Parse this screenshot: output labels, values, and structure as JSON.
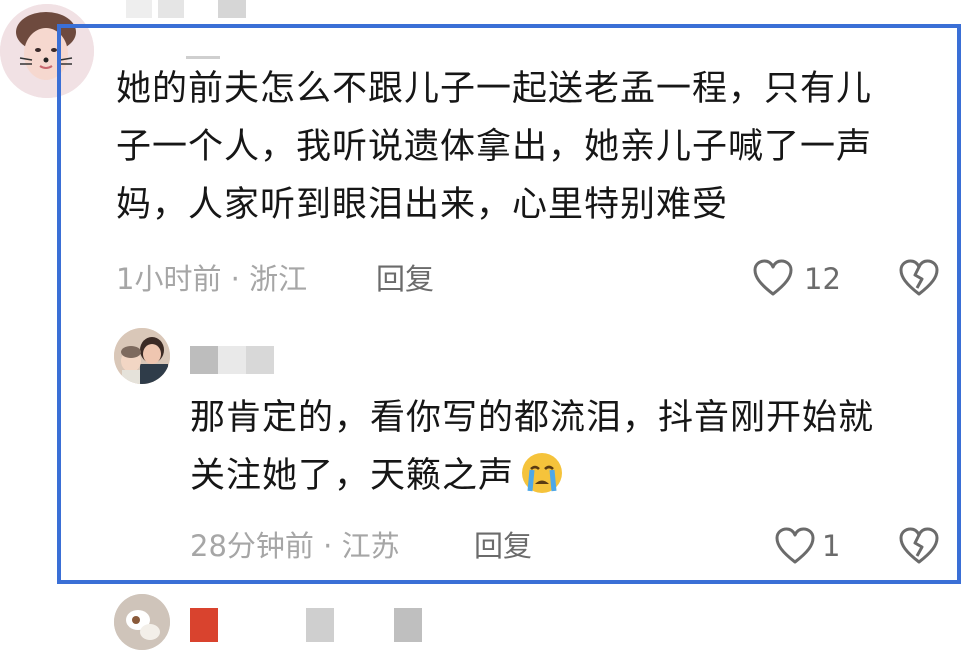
{
  "comment": {
    "text_lines": [
      "她的前夫怎么不跟儿子一起送老孟一程，只有儿",
      "子一个人，我听说遗体拿出，她亲儿子喊了一声",
      "妈，人家听到眼泪出来，心里特别难受"
    ],
    "time": "1小时前",
    "location": "浙江",
    "reply_label": "回复",
    "like_count": "12",
    "icons": [
      "heart-outline-icon",
      "broken-heart-icon"
    ]
  },
  "reply": {
    "text_lines": [
      "那肯定的，看你写的都流泪，抖音刚开始就",
      "关注她了，天籁之声"
    ],
    "emoji": "😭",
    "time": "28分钟前",
    "location": "江苏",
    "reply_label": "回复",
    "like_count": "1",
    "icons": [
      "heart-outline-icon",
      "broken-heart-icon"
    ]
  },
  "colors": {
    "highlight_border": "#3a6fd6",
    "meta_text": "#a6a6a6",
    "action_text": "#6b6b6b",
    "red_badge": "#d9432e"
  }
}
